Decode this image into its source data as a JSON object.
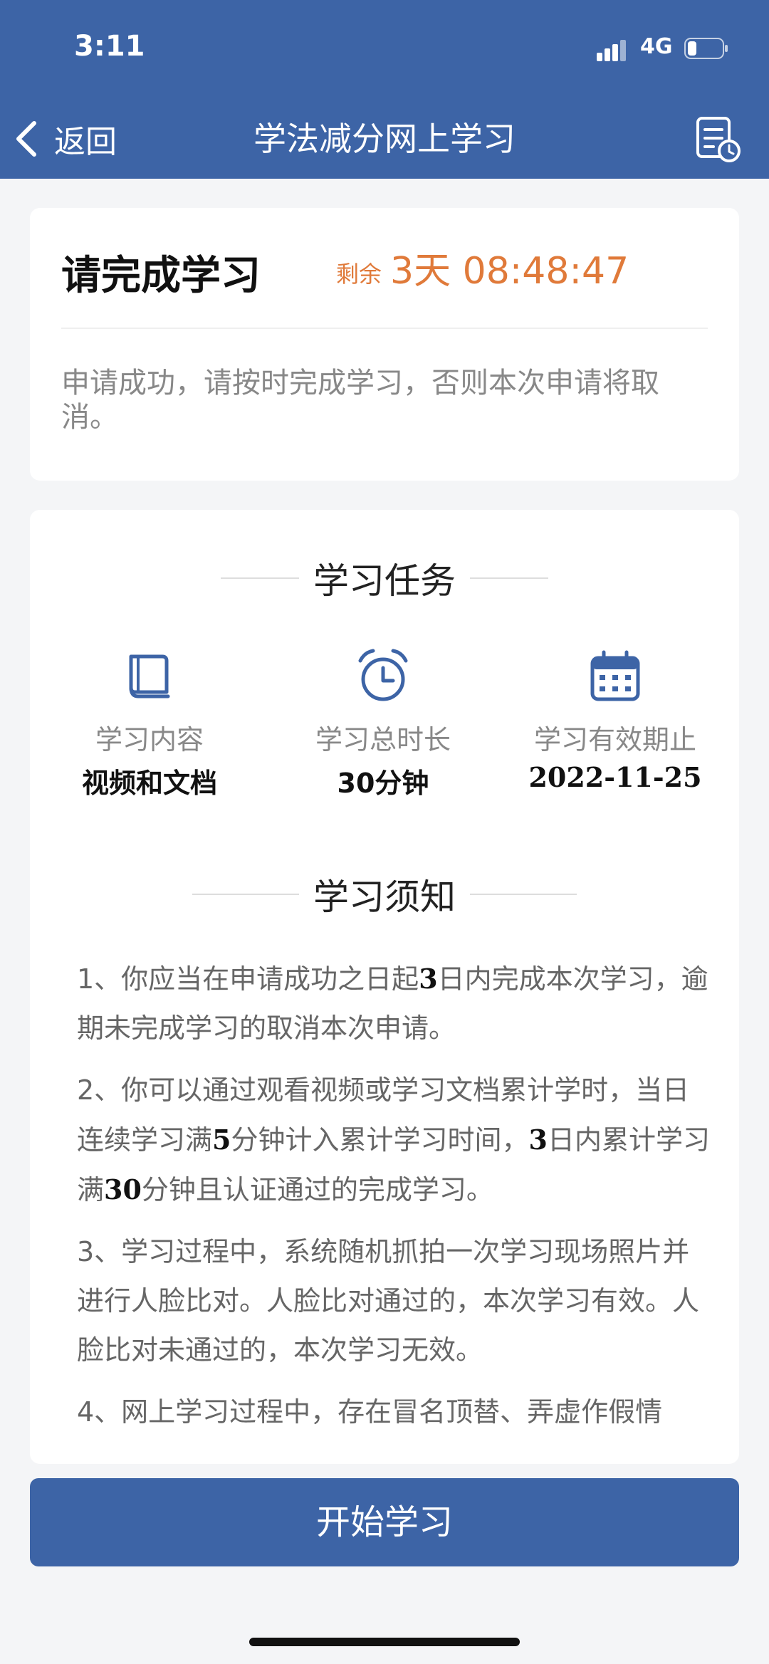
{
  "status_bar": {
    "time": "3:11",
    "network": "4G"
  },
  "nav": {
    "back_label": "返回",
    "title": "学法减分网上学习"
  },
  "status_card": {
    "title": "请完成学习",
    "remaining_label": "剩余",
    "remaining_time": "3天 08:48:47",
    "notice": "申请成功，请按时完成学习，否则本次申请将取消。"
  },
  "task": {
    "heading": "学习任务",
    "items": [
      {
        "label": "学习内容",
        "value": "视频和文档",
        "icon": "book-icon"
      },
      {
        "label": "学习总时长",
        "value": "30分钟",
        "icon": "alarm-clock-icon"
      },
      {
        "label": "学习有效期止",
        "value": "2022-11-25",
        "icon": "calendar-icon"
      }
    ]
  },
  "rules": {
    "heading": "学习须知",
    "items": [
      [
        "1、你应当在申请成功之日起",
        "3",
        "日内完成本次学习，逾期未完成学习的取消本次申请。"
      ],
      [
        "2、你可以通过观看视频或学习文档累计学时，当日连续学习满",
        "5",
        "分钟计入累计学习时间，",
        "3",
        "日内累计学习满",
        "30",
        "分钟且认证通过的完成学习。"
      ],
      [
        "3、学习过程中，系统随机抓拍一次学习现场照片并进行人脸比对。人脸比对通过的，本次学习有效。人脸比对未通过的，本次学习无效。"
      ],
      [
        "4、网上学习过程中，存在冒名顶替、弄虚作假情"
      ]
    ]
  },
  "start_button": {
    "label": "开始学习"
  },
  "colors": {
    "primary": "#3d64a6",
    "accent": "#e07a3a",
    "background": "#f4f5f7"
  }
}
